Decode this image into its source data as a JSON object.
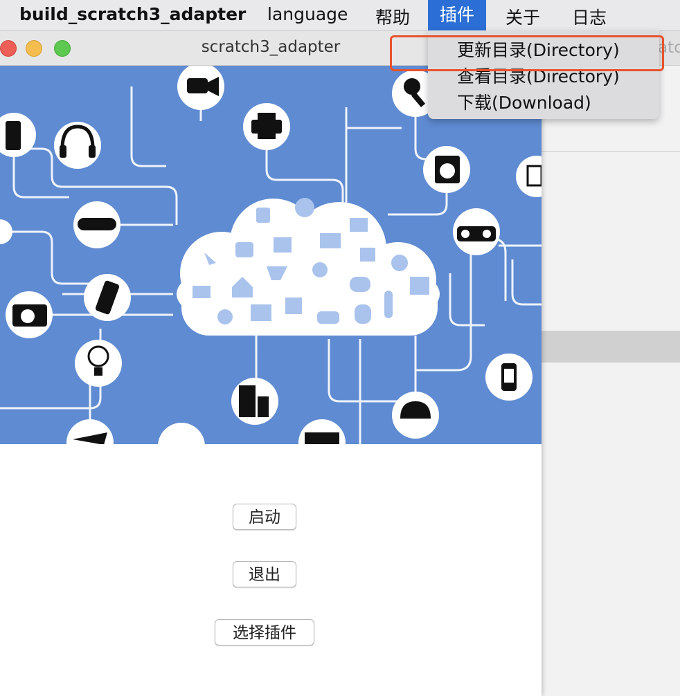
{
  "menubar": {
    "app_name": "build_scratch3_adapter",
    "items": [
      "language",
      "帮助",
      "插件",
      "关于",
      "日志"
    ],
    "active_index": 2
  },
  "plugin_menu": {
    "items": [
      "更新目录(Directory)",
      "查看目录(Directory)",
      "下载(Download)"
    ],
    "highlighted_index": 0
  },
  "window": {
    "title": "scratch3_adapter",
    "background_fragment": "atc"
  },
  "buttons": {
    "start": "启动",
    "quit": "退出",
    "select_plugin": "选择插件"
  },
  "colors": {
    "menu_active": "#2b6fd6",
    "banner_bg": "#5f8bd2",
    "highlight_box": "#e8522d"
  }
}
